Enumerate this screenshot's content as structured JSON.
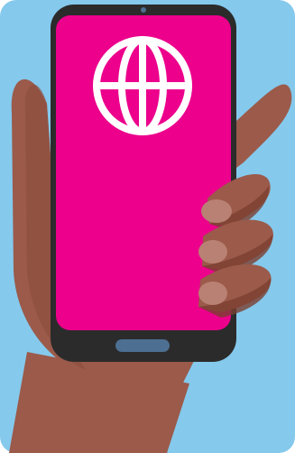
{
  "scene": {
    "description_icon": "globe-icon",
    "colors": {
      "background": "#85c9ec",
      "screen": "#ec008c",
      "phone_body": "#2b2b2b",
      "skin": "#9b5a4a",
      "skin_shadow": "#7a3e30",
      "nail": "#b98173",
      "home_button": "#4d6f92",
      "icon": "#ffffff"
    }
  }
}
